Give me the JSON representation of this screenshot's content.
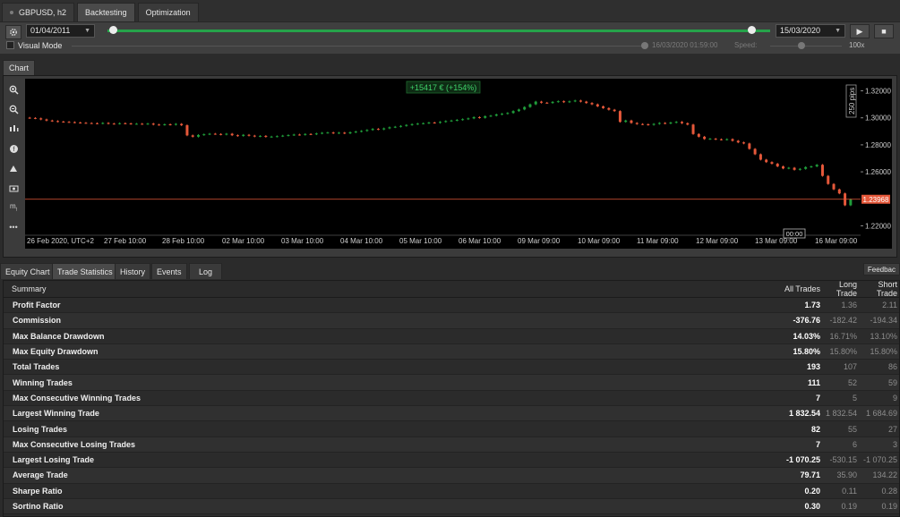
{
  "top_tabs": [
    {
      "label": "GBPUSD, h2"
    },
    {
      "label": "Backtesting"
    },
    {
      "label": "Optimization"
    }
  ],
  "controls": {
    "start_date": "01/04/2011",
    "end_date": "15/03/2020",
    "progress": 1.0,
    "visual_mode_label": "Visual Mode",
    "visual_time": "16/03/2020 01:59:00",
    "speed_label": "Speed:",
    "speed_value": "100x"
  },
  "chart_tab": "Chart",
  "chart_data": {
    "type": "candlestick",
    "symbol": "GBPUSD",
    "profit_label": "+15417 € (+154%)",
    "scale_label": "250 pips",
    "y_ticks": [
      "1.32000",
      "1.30000",
      "1.28000",
      "1.26000",
      "1.22000"
    ],
    "ylim": [
      1.215,
      1.325
    ],
    "current_price": 1.23968,
    "current_price_label": "1.23968",
    "x_ticks": [
      "26 Feb 2020, UTC+2",
      "27 Feb 10:00",
      "28 Feb 10:00",
      "02 Mar 10:00",
      "03 Mar 10:00",
      "04 Mar 10:00",
      "05 Mar 10:00",
      "06 Mar 10:00",
      "09 Mar 09:00",
      "10 Mar 09:00",
      "11 Mar 09:00",
      "12 Mar 09:00",
      "13 Mar 09:00",
      "16 Mar 09:00"
    ],
    "cursor_time": "00:00",
    "closes": [
      1.2999,
      1.2996,
      1.2988,
      1.298,
      1.2976,
      1.2972,
      1.297,
      1.2968,
      1.2965,
      1.2963,
      1.2961,
      1.296,
      1.2958,
      1.2962,
      1.2957,
      1.2956,
      1.296,
      1.2958,
      1.2955,
      1.2956,
      1.2954,
      1.2957,
      1.295,
      1.2948,
      1.2952,
      1.2949,
      1.2955,
      1.2945,
      1.287,
      1.286,
      1.2873,
      1.2878,
      1.2882,
      1.288,
      1.2876,
      1.2882,
      1.2871,
      1.2866,
      1.2874,
      1.2868,
      1.2862,
      1.2866,
      1.2859,
      1.2861,
      1.2864,
      1.2868,
      1.2872,
      1.2876,
      1.2874,
      1.288,
      1.2878,
      1.2884,
      1.2889,
      1.2891,
      1.2886,
      1.289,
      1.2885,
      1.2893,
      1.2898,
      1.2903,
      1.291,
      1.2918,
      1.2914,
      1.2922,
      1.293,
      1.2934,
      1.294,
      1.2947,
      1.2953,
      1.2957,
      1.296,
      1.2965,
      1.2963,
      1.297,
      1.2976,
      1.298,
      1.2985,
      1.299,
      1.2996,
      1.3005,
      1.3,
      1.3012,
      1.3016,
      1.3025,
      1.303,
      1.3036,
      1.305,
      1.3062,
      1.308,
      1.31,
      1.312,
      1.3112,
      1.311,
      1.3118,
      1.3123,
      1.3116,
      1.3122,
      1.3128,
      1.312,
      1.311,
      1.31,
      1.3085,
      1.3072,
      1.306,
      1.305,
      1.297,
      1.298,
      1.2962,
      1.2954,
      1.2952,
      1.2948,
      1.2955,
      1.2962,
      1.2958,
      1.2965,
      1.297,
      1.296,
      1.295,
      1.288,
      1.286,
      1.2843,
      1.2845,
      1.2841,
      1.2838,
      1.2842,
      1.283,
      1.2818,
      1.281,
      1.277,
      1.273,
      1.269,
      1.2672,
      1.266,
      1.264,
      1.2625,
      1.263,
      1.2615,
      1.2622,
      1.2635,
      1.264,
      1.2652,
      1.257,
      1.251,
      1.247,
      1.244,
      1.2352,
      1.2396
    ],
    "opens": [
      1.3001,
      1.2999,
      1.2996,
      1.2988,
      1.298,
      1.2976,
      1.2972,
      1.297,
      1.2968,
      1.2965,
      1.2963,
      1.2961,
      1.296,
      1.2958,
      1.2962,
      1.2957,
      1.2956,
      1.296,
      1.2958,
      1.2955,
      1.2956,
      1.2954,
      1.2957,
      1.295,
      1.2948,
      1.2952,
      1.2949,
      1.2955,
      1.2945,
      1.287,
      1.286,
      1.2873,
      1.2878,
      1.2882,
      1.288,
      1.2876,
      1.2882,
      1.2871,
      1.2866,
      1.2874,
      1.2868,
      1.2862,
      1.2866,
      1.2859,
      1.2861,
      1.2864,
      1.2868,
      1.2872,
      1.2876,
      1.2874,
      1.288,
      1.2878,
      1.2884,
      1.2889,
      1.2891,
      1.2886,
      1.289,
      1.2885,
      1.2893,
      1.2898,
      1.2903,
      1.291,
      1.2918,
      1.2914,
      1.2922,
      1.293,
      1.2934,
      1.294,
      1.2947,
      1.2953,
      1.2957,
      1.296,
      1.2965,
      1.2963,
      1.297,
      1.2976,
      1.298,
      1.2985,
      1.299,
      1.2996,
      1.3005,
      1.3,
      1.3012,
      1.3016,
      1.3025,
      1.303,
      1.3036,
      1.305,
      1.3062,
      1.308,
      1.31,
      1.312,
      1.3112,
      1.311,
      1.3118,
      1.3123,
      1.3116,
      1.3122,
      1.3128,
      1.312,
      1.311,
      1.31,
      1.3085,
      1.3072,
      1.306,
      1.305,
      1.297,
      1.298,
      1.2962,
      1.2954,
      1.2952,
      1.2948,
      1.2955,
      1.2962,
      1.2958,
      1.2965,
      1.297,
      1.296,
      1.295,
      1.288,
      1.286,
      1.2843,
      1.2845,
      1.2841,
      1.2838,
      1.2842,
      1.283,
      1.2818,
      1.281,
      1.277,
      1.273,
      1.269,
      1.2672,
      1.266,
      1.264,
      1.2625,
      1.263,
      1.2615,
      1.2622,
      1.2635,
      1.264,
      1.2652,
      1.257,
      1.251,
      1.247,
      1.244,
      1.2352
    ]
  },
  "bottom_tabs": [
    {
      "label": "Equity Chart"
    },
    {
      "label": "Trade Statistics"
    },
    {
      "label": "History"
    },
    {
      "label": "Events"
    },
    {
      "label": "Log"
    }
  ],
  "feedback_label": "Feedbac",
  "stats": {
    "header": {
      "name": "Summary",
      "all": "All Trades",
      "long": "Long Trade",
      "short": "Short Trade"
    },
    "rows": [
      {
        "name": "Profit Factor",
        "all": "1.73",
        "long": "1.36",
        "short": "2.11"
      },
      {
        "name": "Commission",
        "all": "-376.76",
        "long": "-182.42",
        "short": "-194.34"
      },
      {
        "name": "Max Balance Drawdown",
        "all": "14.03%",
        "long": "16.71%",
        "short": "13.10%"
      },
      {
        "name": "Max Equity Drawdown",
        "all": "15.80%",
        "long": "15.80%",
        "short": "15.80%"
      },
      {
        "name": "Total Trades",
        "all": "193",
        "long": "107",
        "short": "86"
      },
      {
        "name": "Winning Trades",
        "all": "111",
        "long": "52",
        "short": "59"
      },
      {
        "name": "Max Consecutive Winning Trades",
        "all": "7",
        "long": "5",
        "short": "9"
      },
      {
        "name": "Largest Winning Trade",
        "all": "1 832.54",
        "long": "1 832.54",
        "short": "1 684.69"
      },
      {
        "name": "Losing Trades",
        "all": "82",
        "long": "55",
        "short": "27"
      },
      {
        "name": "Max Consecutive Losing Trades",
        "all": "7",
        "long": "6",
        "short": "3"
      },
      {
        "name": "Largest Losing Trade",
        "all": "-1 070.25",
        "long": "-530.15",
        "short": "-1 070.25"
      },
      {
        "name": "Average Trade",
        "all": "79.71",
        "long": "35.90",
        "short": "134.22"
      },
      {
        "name": "Sharpe Ratio",
        "all": "0.20",
        "long": "0.11",
        "short": "0.28"
      },
      {
        "name": "Sortino Ratio",
        "all": "0.30",
        "long": "0.19",
        "short": "0.19"
      }
    ]
  },
  "colors": {
    "up": "#1f9d3a",
    "down": "#e5583a",
    "progress": "#26a34a",
    "price_line": "#e5583a"
  }
}
